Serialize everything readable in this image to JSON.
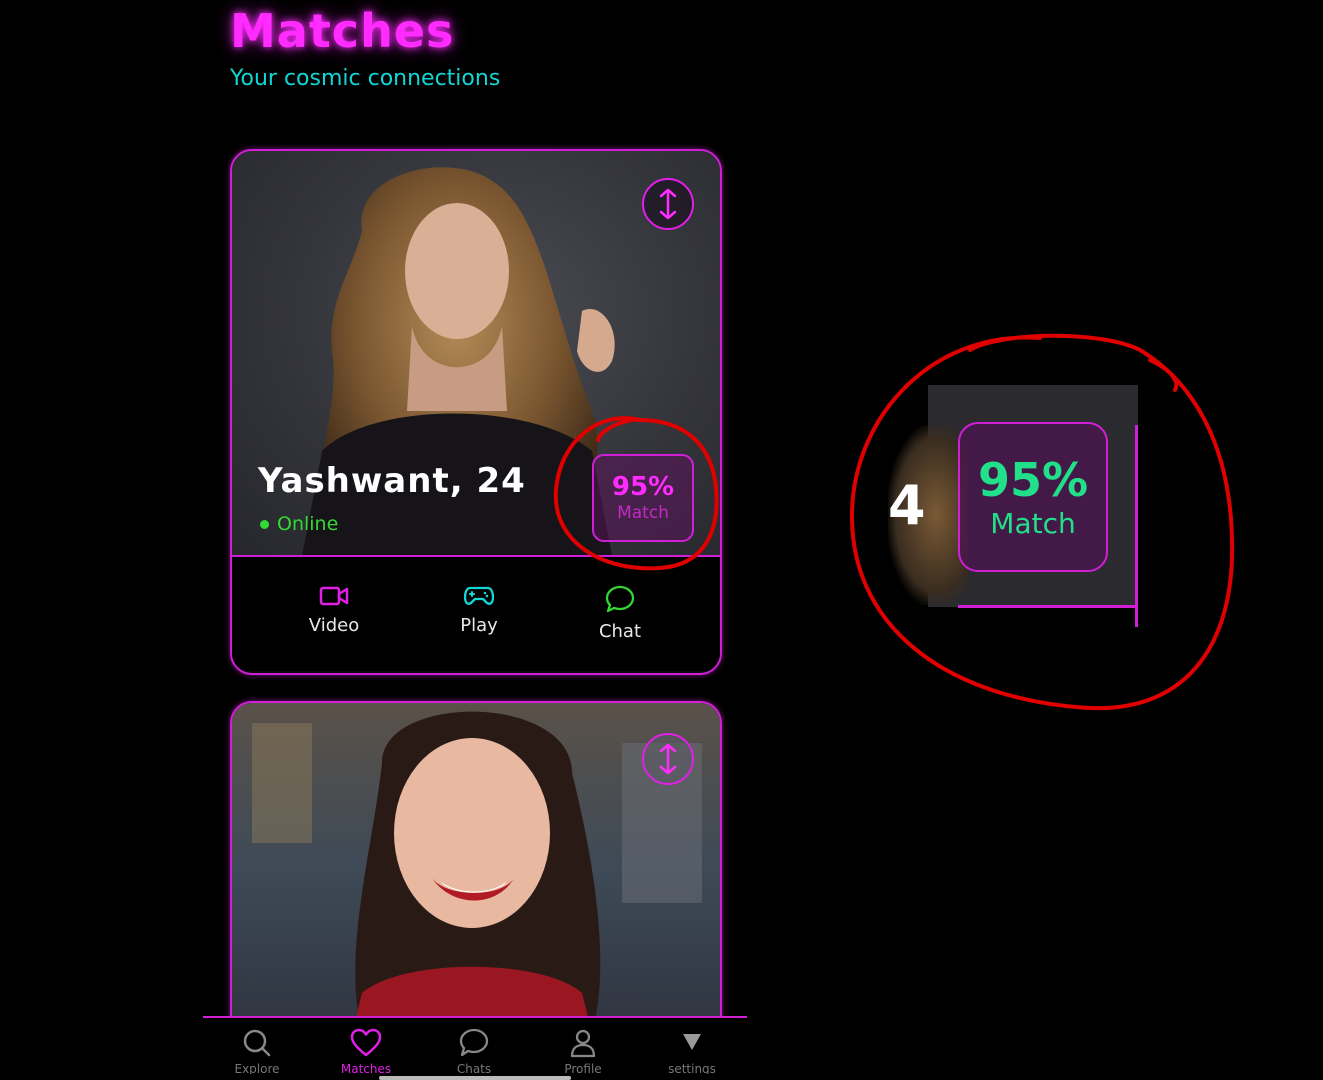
{
  "header": {
    "title": "Matches",
    "subtitle": "Your cosmic connections"
  },
  "cards": [
    {
      "name_age": "Yashwant, 24",
      "status": "Online",
      "match_percent": "95%",
      "match_label": "Match",
      "actions": [
        {
          "label": "Video",
          "icon": "video-camera-icon"
        },
        {
          "label": "Play",
          "icon": "gamepad-icon"
        },
        {
          "label": "Chat",
          "icon": "chat-bubble-icon"
        }
      ]
    }
  ],
  "zoom_callout": {
    "number": "4",
    "match_percent": "95%",
    "match_label": "Match"
  },
  "nav": [
    {
      "label": "Explore",
      "icon": "search-icon"
    },
    {
      "label": "Matches",
      "icon": "heart-icon",
      "active": true
    },
    {
      "label": "Chats",
      "icon": "chat-bubble-icon"
    },
    {
      "label": "Profile",
      "icon": "user-icon"
    },
    {
      "label": "settings",
      "icon": "triangle-down-icon"
    }
  ],
  "colors": {
    "accent_magenta": "#d11fd6",
    "title_magenta": "#ff2bff",
    "subtitle_cyan": "#12d6d6",
    "online_green": "#34d834",
    "zoom_match_green": "#22e08a",
    "annotation_red": "#e00000"
  }
}
